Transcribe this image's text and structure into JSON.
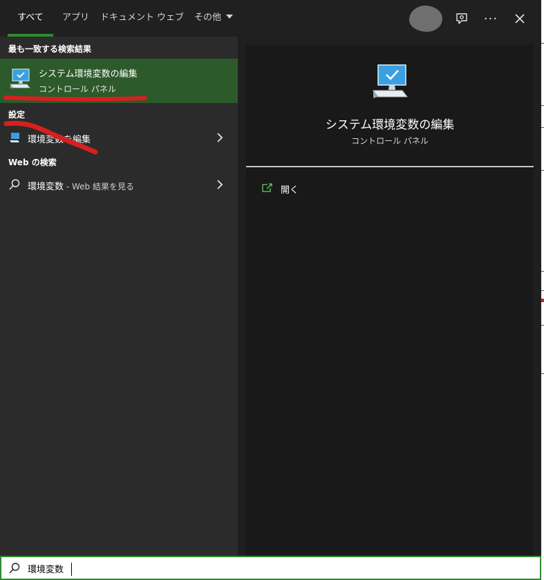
{
  "tabs": [
    {
      "label": "すべて",
      "active": true
    },
    {
      "label": "アプリ"
    },
    {
      "label": "ドキュメント"
    },
    {
      "label": "ウェブ"
    },
    {
      "label": "その他"
    }
  ],
  "toolbar": {
    "feedback_icon": "feedback-icon",
    "more_icon": "more-icon",
    "more_glyph": "···",
    "close_icon": "close-icon"
  },
  "results": {
    "best_match_header": "最も一致する検索結果",
    "best_match": {
      "title": "システム環境変数の編集",
      "subtitle": "コントロール パネル",
      "icon": "system-computer-icon"
    },
    "settings_header": "設定",
    "settings_item": {
      "label": "環境変数を編集",
      "icon": "settings-computer-icon"
    },
    "web_header": "Web の検索",
    "web_item": {
      "query": "環境変数",
      "suffix": " - Web 結果を見る",
      "icon": "search-icon"
    }
  },
  "preview": {
    "title": "システム環境変数の編集",
    "subtitle": "コントロール パネル",
    "action_open": "開く",
    "icon": "system-computer-icon"
  },
  "search": {
    "value": "環境変数",
    "icon": "search-icon"
  },
  "colors": {
    "accent": "#2e8b2e",
    "selected_bg": "#2d5a2a",
    "annotation_red": "#d81f1f"
  }
}
